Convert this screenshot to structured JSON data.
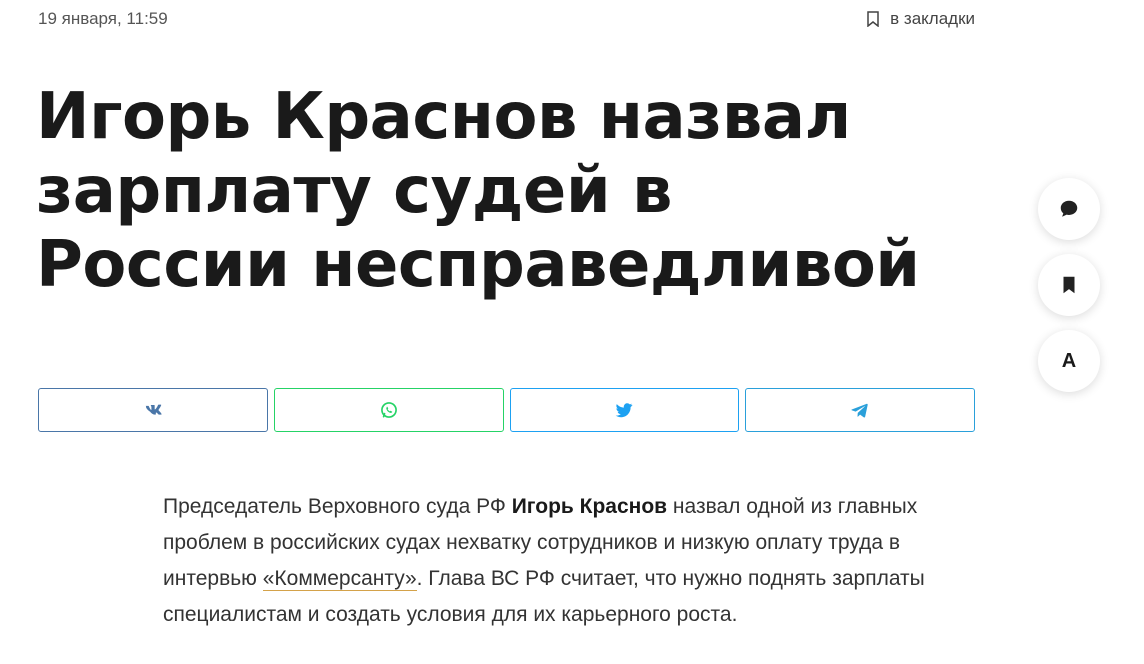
{
  "meta": {
    "date": "19 января, 11:59",
    "bookmark_label": "в закладки"
  },
  "article": {
    "title": "Игорь Краснов назвал зарплату судей в России несправедливой",
    "lead": {
      "p1": "Председатель Верховного суда РФ ",
      "bold": "Игорь Краснов",
      "p2": " назвал одной из главных проблем в российских судах нехватку сотрудников и низкую оплату труда в интервью ",
      "link": "«Коммерсанту»",
      "p3": ". Глава ВС РФ считает, что нужно поднять зарплаты специалистам и создать условия для их карьерного роста."
    }
  },
  "share": [
    {
      "icon": "vk-icon",
      "color": "#4a76a8"
    },
    {
      "icon": "whatsapp-icon",
      "color": "#25d366"
    },
    {
      "icon": "twitter-icon",
      "color": "#1da1f2"
    },
    {
      "icon": "telegram-icon",
      "color": "#2aa0da"
    }
  ],
  "tools": {
    "font_label": "A"
  }
}
